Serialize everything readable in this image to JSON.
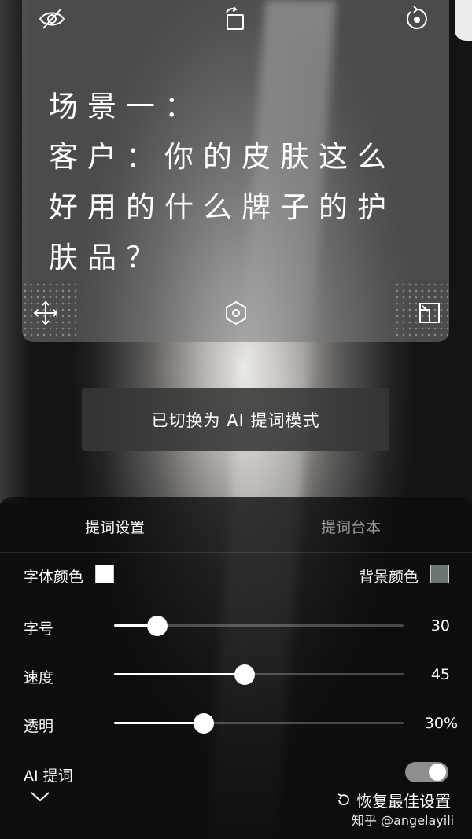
{
  "prompter": {
    "text": "场景一：\n客户：你的皮肤这么好用的什么牌子的护肤品？"
  },
  "icons": {
    "hide": "eye-off-icon",
    "rotate_screen": "rotate-screen-icon",
    "reset_rotation": "rotate-reset-icon",
    "move": "move-icon",
    "center": "hexagon-icon",
    "resize": "resize-icon",
    "reset": "refresh-icon",
    "collapse": "chevron-down-icon"
  },
  "toast": {
    "text": "已切换为 AI 提词模式"
  },
  "tabs": [
    {
      "label": "提词设置",
      "active": true
    },
    {
      "label": "提词台本",
      "active": false
    }
  ],
  "colors": {
    "font_label": "字体颜色",
    "font_color": "#ffffff",
    "bg_label": "背景颜色",
    "bg_color": "#6b7373"
  },
  "sliders": [
    {
      "label": "字号",
      "value": "30",
      "fraction": 0.15
    },
    {
      "label": "速度",
      "value": "45",
      "fraction": 0.45
    },
    {
      "label": "透明",
      "value": "30%",
      "fraction": 0.31
    }
  ],
  "ai_prompt": {
    "label": "AI 提词",
    "enabled": true
  },
  "reset_label": "恢复最佳设置",
  "watermark": "知乎 @angelayili"
}
